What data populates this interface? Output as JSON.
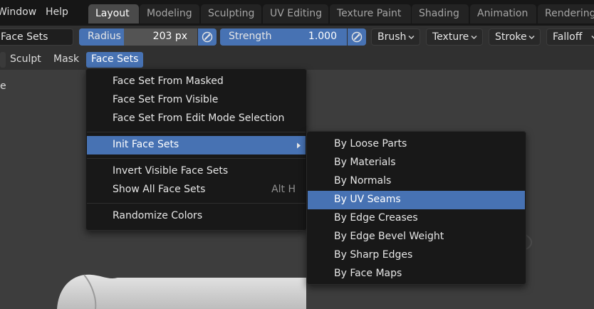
{
  "topbar": {
    "menus": [
      "Window",
      "Help"
    ],
    "workspaces": [
      {
        "label": "Layout",
        "active": true
      },
      {
        "label": "Modeling",
        "active": false
      },
      {
        "label": "Sculpting",
        "active": false
      },
      {
        "label": "UV Editing",
        "active": false
      },
      {
        "label": "Texture Paint",
        "active": false
      },
      {
        "label": "Shading",
        "active": false
      },
      {
        "label": "Animation",
        "active": false
      },
      {
        "label": "Rendering",
        "active": false
      }
    ]
  },
  "toolbar": {
    "mode_field": "Face Sets",
    "radius": {
      "label": "Radius",
      "value": "203 px"
    },
    "strength": {
      "label": "Strength",
      "value": "1.000",
      "fraction": 1.0
    },
    "dropdowns": [
      "Brush",
      "Texture",
      "Stroke",
      "Falloff"
    ]
  },
  "header": {
    "menus": [
      "Sculpt",
      "Mask",
      "Face Sets"
    ],
    "active": "Face Sets"
  },
  "viewport": {
    "label": "e"
  },
  "face_sets_menu": {
    "items": [
      {
        "label": "Face Set From Masked"
      },
      {
        "label": "Face Set From Visible"
      },
      {
        "label": "Face Set From Edit Mode Selection"
      },
      {
        "label": "Init Face Sets",
        "submenu": true,
        "highlighted": true
      },
      {
        "label": "Invert Visible Face Sets"
      },
      {
        "label": "Show All Face Sets",
        "shortcut": "Alt H"
      },
      {
        "label": "Randomize Colors"
      }
    ]
  },
  "init_face_sets_submenu": {
    "items": [
      {
        "label": "By Loose Parts"
      },
      {
        "label": "By Materials"
      },
      {
        "label": "By Normals"
      },
      {
        "label": "By UV Seams",
        "highlighted": true
      },
      {
        "label": "By Edge Creases"
      },
      {
        "label": "By Edge Bevel Weight"
      },
      {
        "label": "By Sharp Edges"
      },
      {
        "label": "By Face Maps"
      }
    ]
  },
  "colors": {
    "accent": "#4772b3",
    "menu_bg": "#181818",
    "viewport_bg": "#3d3d3d"
  }
}
